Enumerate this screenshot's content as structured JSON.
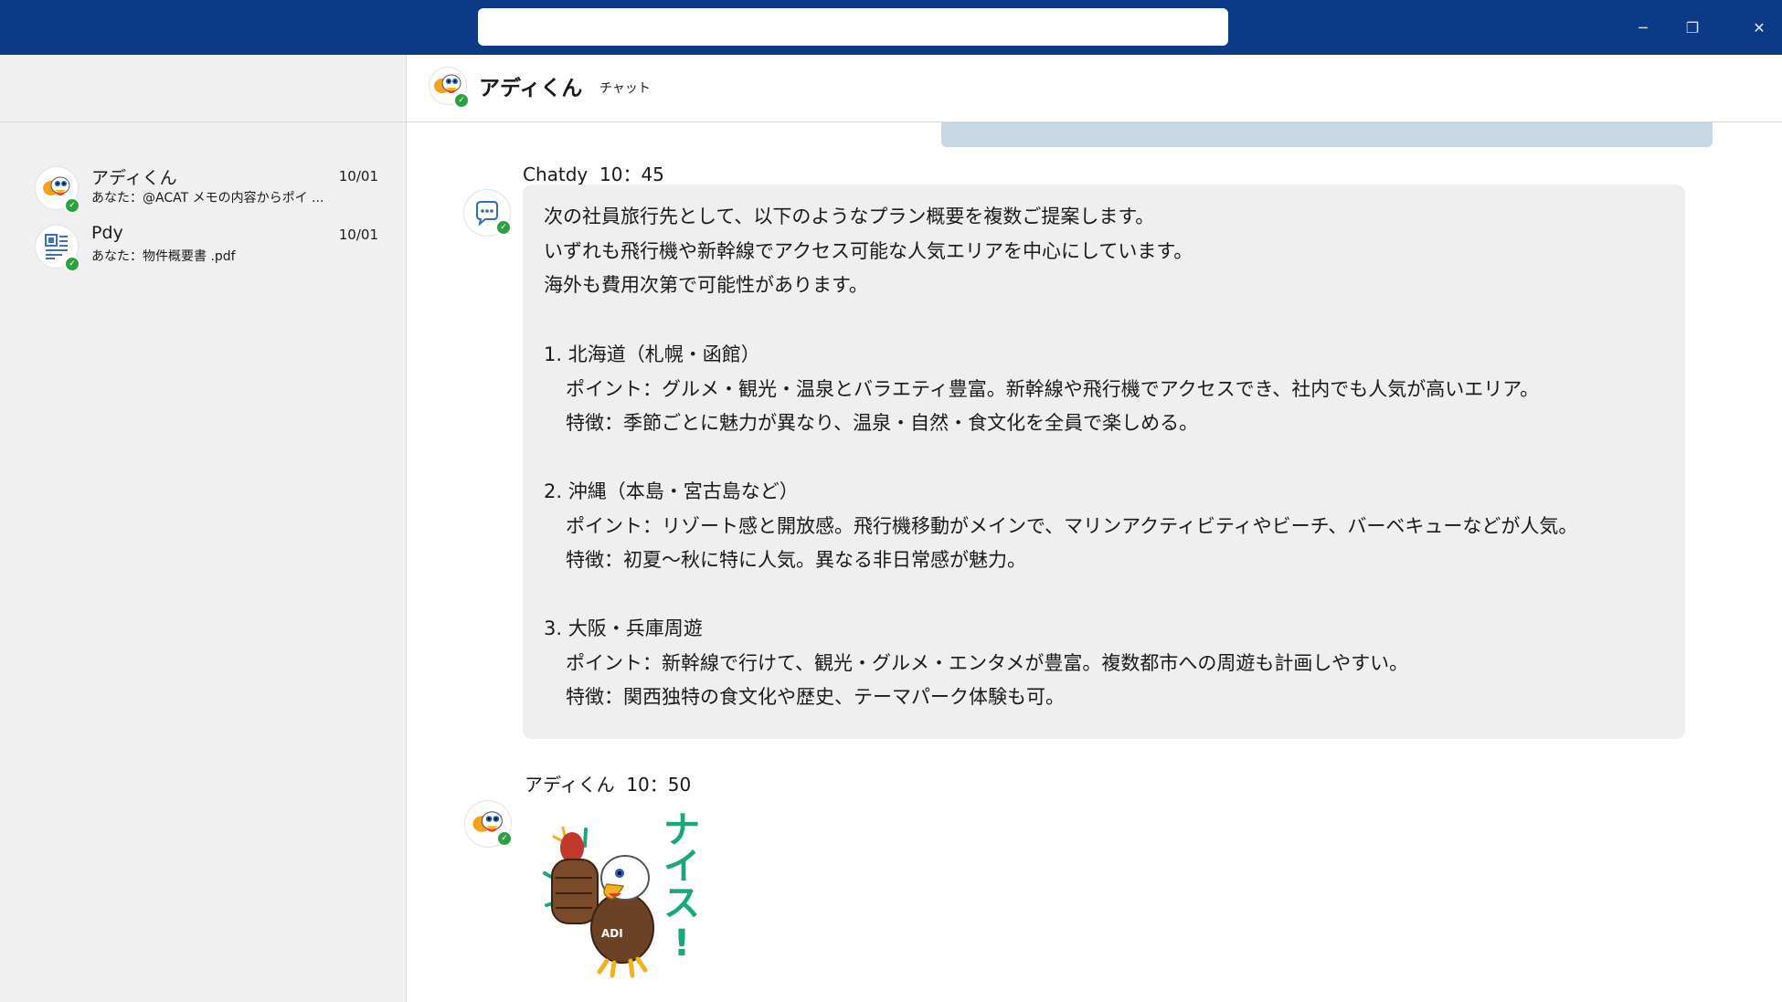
{
  "window": {
    "search": {
      "value": "",
      "placeholder": ""
    },
    "controls": {
      "minimize": "─",
      "restore": "❐",
      "close": "✕"
    }
  },
  "sidebar": {
    "conversations": [
      {
        "name": "アディくん",
        "date": "10/01",
        "preview": "あなた：@ACAT メモの内容からポイ ..."
      },
      {
        "name": "Pdy",
        "date": "10/01",
        "preview": "あなた：物件概要書 .pdf"
      }
    ]
  },
  "chat": {
    "title": "アディくん",
    "tab": "チャット",
    "messages": [
      {
        "sender": "Chatdy",
        "time": "10：45",
        "lines": [
          "次の社員旅行先として、以下のようなプラン概要を複数ご提案します。",
          "いずれも飛行機や新幹線でアクセス可能な人気エリアを中心にしています。",
          "海外も費用次第で可能性があります。",
          "1. 北海道（札幌・函館）",
          "ポイント：グルメ・観光・温泉とバラエティ豊富。新幹線や飛行機でアクセスでき、社内でも人気が高いエリア。",
          "特徴：季節ごとに魅力が異なり、温泉・自然・食文化を全員で楽しめる。",
          "2. 沖縄（本島・宮古島など）",
          "ポイント：リゾート感と開放感。飛行機移動がメインで、マリンアクティビティやビーチ、バーベキューなどが人気。",
          "特徴：初夏～秋に特に人気。異なる非日常感が魅力。",
          "3. 大阪・兵庫周遊",
          "ポイント：新幹線で行けて、観光・グルメ・エンタメが豊富。複数都市への周遊も計画しやすい。",
          "特徴：関西独特の食文化や歴史、テーマパーク体験も可。"
        ]
      },
      {
        "sender": "アディくん",
        "time": "10：50",
        "sticker": {
          "text": "ナイス!",
          "badge": "ADI"
        }
      }
    ]
  },
  "colors": {
    "titlebar": "#0d3a86",
    "sidebar": "#f0f0f0",
    "bubble": "#efefef",
    "own_bubble": "#c9d8e4",
    "presence": "#2ea043",
    "sticker_text": "#1aa87a"
  },
  "icons": [
    "duck-mascot-avatar",
    "document-avatar",
    "chat-bot-avatar",
    "presence-check-icon"
  ]
}
